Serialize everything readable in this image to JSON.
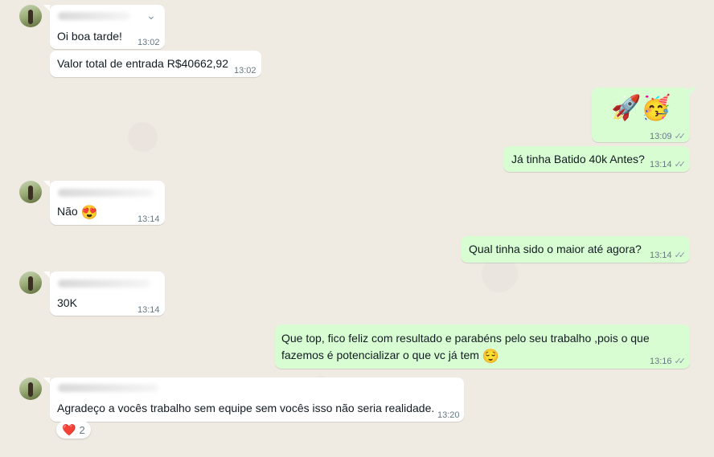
{
  "messages": [
    {
      "dir": "in",
      "text": "Oi boa tarde!",
      "time": "13:02"
    },
    {
      "dir": "in",
      "text": "Valor total de entrada R$40662,92",
      "time": "13:02"
    },
    {
      "dir": "out",
      "text": "🚀🥳",
      "time": "13:09",
      "status": "read"
    },
    {
      "dir": "out",
      "text": "Já tinha Batido 40k Antes?",
      "time": "13:14",
      "status": "read"
    },
    {
      "dir": "in",
      "text": "Não",
      "emoji": "😍",
      "time": "13:14"
    },
    {
      "dir": "out",
      "text": "Qual tinha sido o maior até agora?",
      "time": "13:14",
      "status": "read"
    },
    {
      "dir": "in",
      "text": "30K",
      "time": "13:14"
    },
    {
      "dir": "out",
      "text_line1": "Que top, fico feliz com resultado e parabéns pelo seu trabalho ,pois o que",
      "text_line2": "fazemos é potencializar o que vc já tem",
      "emoji": "😌",
      "time": "13:16",
      "status": "read"
    },
    {
      "dir": "in",
      "text": "Agradeço a vocês trabalho sem equipe sem vocês isso não seria realidade.",
      "time": "13:20"
    }
  ],
  "reaction": {
    "emoji": "❤️",
    "count": "2"
  },
  "icons": {
    "read_receipt": "double-check-icon",
    "menu": "chevron-down-icon"
  }
}
